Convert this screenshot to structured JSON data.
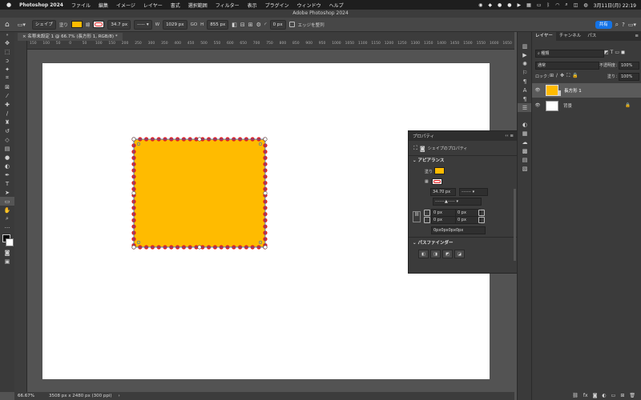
{
  "menubar": {
    "app": "Photoshop 2024",
    "items": [
      "ファイル",
      "編集",
      "イメージ",
      "レイヤー",
      "書式",
      "選択範囲",
      "フィルター",
      "表示",
      "プラグイン",
      "ウィンドウ",
      "ヘルプ"
    ],
    "datetime": "3月11日(月) 22:19"
  },
  "window": {
    "title": "Adobe Photoshop 2024"
  },
  "options": {
    "mode": "シェイプ",
    "fill_label": "塗り",
    "stroke_label": "線",
    "stroke_width": "34.7 px",
    "w_label": "W",
    "w_value": "1029 px",
    "link": "GO",
    "h_label": "H",
    "h_value": "855 px",
    "radius": "0 px",
    "align_edges": "エッジを整列",
    "share": "共有"
  },
  "document": {
    "tab": "名称未設定 1 @ 66.7% (長方形 1, RGB/8) *",
    "zoom": "66.67%",
    "size_info": "3508 px x 2480 px (300 ppi)"
  },
  "ruler_ticks": [
    "150",
    "100",
    "50",
    "0",
    "50",
    "100",
    "150",
    "200",
    "250",
    "300",
    "350",
    "400",
    "450",
    "500",
    "550",
    "600",
    "650",
    "700",
    "750",
    "800",
    "850",
    "900",
    "950",
    "1000",
    "1050",
    "1100",
    "1150",
    "1200",
    "1250",
    "1300",
    "1350",
    "1400",
    "1450",
    "1500",
    "1550",
    "1600",
    "1650"
  ],
  "properties": {
    "tab": "プロパティ",
    "shape_props": "シェイプのプロパティ",
    "appearance": "アピアランス",
    "fill": "塗り",
    "stroke_width": "34.70 px",
    "corner1": "0 px",
    "corner2": "0 px",
    "corner3": "0 px",
    "corner4": "0 px",
    "corners_all": "0px0px0px0px",
    "pathfinder": "パスファインダー"
  },
  "layers_panel": {
    "tabs": [
      "レイヤー",
      "チャンネル",
      "パス"
    ],
    "search": "種類",
    "blend": "通常",
    "opacity_label": "不透明度：",
    "opacity": "100%",
    "lock_label": "ロック：",
    "fill_label": "塗り：",
    "fill": "100%",
    "layers": [
      {
        "name": "長方形 1",
        "selected": true
      },
      {
        "name": "背景",
        "locked": true
      }
    ]
  },
  "colors": {
    "shape_fill": "#ffbb00",
    "stroke": "#e02020",
    "accent": "#1473e6"
  }
}
